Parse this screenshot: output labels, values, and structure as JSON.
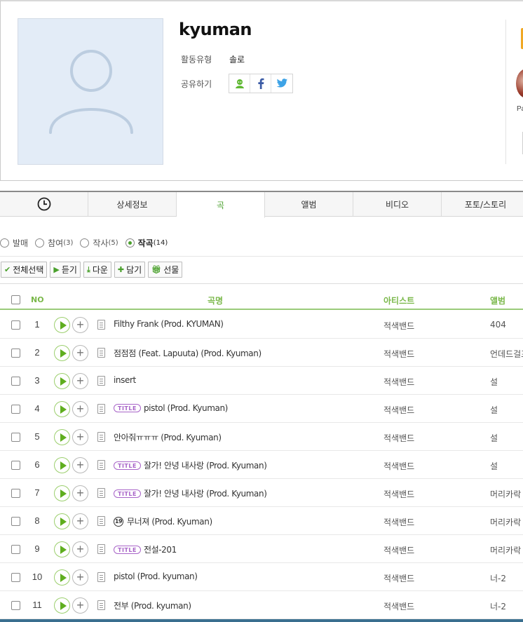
{
  "profile": {
    "name": "kyuman",
    "activity_label": "활동유형",
    "activity_value": "솔로",
    "share_label": "공유하기",
    "share_icons": [
      "melon-friend-icon",
      "facebook-icon",
      "twitter-icon"
    ],
    "side_text": "Pa"
  },
  "tabs": [
    "history-icon",
    "상세정보",
    "곡",
    "앨범",
    "비디오",
    "포토/스토리"
  ],
  "active_tab": "곡",
  "filters": [
    {
      "label": "발매",
      "count": ""
    },
    {
      "label": "참여",
      "count": "(3)"
    },
    {
      "label": "작사",
      "count": "(5)"
    },
    {
      "label": "작곡",
      "count": "(14)",
      "selected": true
    }
  ],
  "toolbar": {
    "select_all": "전체선택",
    "listen": "듣기",
    "download": "다운",
    "add": "담기",
    "gift": "선물"
  },
  "table": {
    "headers": {
      "no": "NO",
      "song": "곡명",
      "artist": "아티스트",
      "album": "앨범"
    },
    "rows": [
      {
        "no": "1",
        "title": "Filthy Frank (Prod. KYUMAN)",
        "badge": "",
        "artist": "적색밴드",
        "album": "404"
      },
      {
        "no": "2",
        "title": "점점점 (Feat. Lapuuta) (Prod. Kyuman)",
        "badge": "",
        "artist": "적색밴드",
        "album": "언데드걸프"
      },
      {
        "no": "3",
        "title": "insert",
        "badge": "",
        "artist": "적색밴드",
        "album": "설"
      },
      {
        "no": "4",
        "title": "pistol (Prod. Kyuman)",
        "badge": "TITLE",
        "artist": "적색밴드",
        "album": "설"
      },
      {
        "no": "5",
        "title": "안아줘ㅠㅠㅠ (Prod. Kyuman)",
        "badge": "",
        "artist": "적색밴드",
        "album": "설"
      },
      {
        "no": "6",
        "title": "잘가! 안녕 내사랑 (Prod. Kyuman)",
        "badge": "TITLE",
        "artist": "적색밴드",
        "album": "설"
      },
      {
        "no": "7",
        "title": "잘가! 안녕 내사랑 (Prod. Kyuman)",
        "badge": "TITLE",
        "artist": "적색밴드",
        "album": "머리카락"
      },
      {
        "no": "8",
        "title": "무너져 (Prod. Kyuman)",
        "badge": "",
        "age": "19",
        "artist": "적색밴드",
        "album": "머리카락"
      },
      {
        "no": "9",
        "title": "전설-201",
        "badge": "TITLE",
        "artist": "적색밴드",
        "album": "머리카락"
      },
      {
        "no": "10",
        "title": "pistol (Prod. kyuman)",
        "badge": "",
        "artist": "적색밴드",
        "album": "너-2"
      },
      {
        "no": "11",
        "title": "전부 (Prod. kyuman)",
        "badge": "",
        "artist": "적색밴드",
        "album": "너-2"
      }
    ]
  },
  "colors": {
    "accent": "#4aa02c",
    "header_text": "#7ab84a",
    "title_badge": "#a864c8"
  }
}
